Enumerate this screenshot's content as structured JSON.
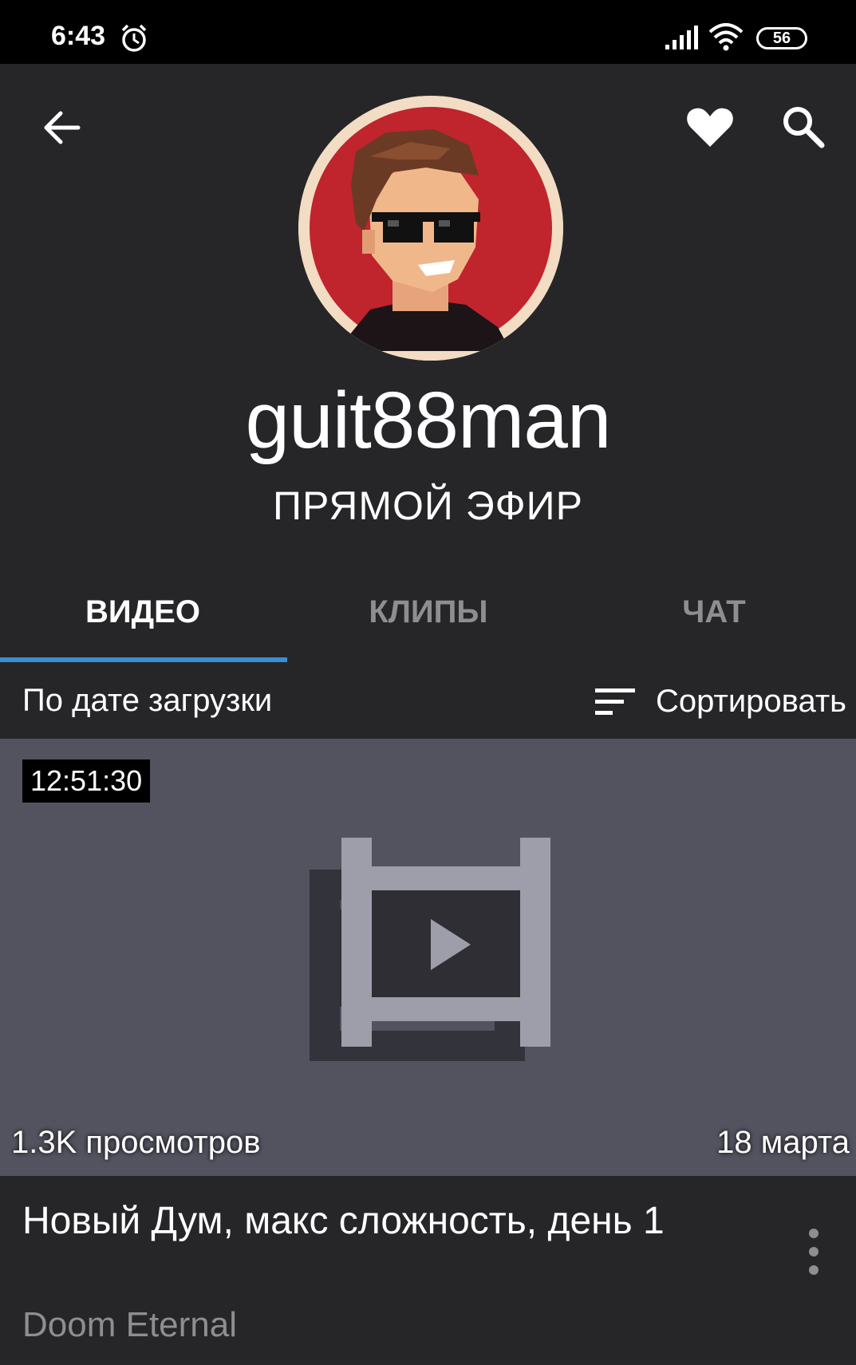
{
  "status_bar": {
    "time": "6:43",
    "battery": "56"
  },
  "header": {
    "channel_name": "guit88man",
    "live_label": "ПРЯМОЙ ЭФИР"
  },
  "tabs": [
    {
      "label": "ВИДЕО",
      "active": true
    },
    {
      "label": "КЛИПЫ",
      "active": false
    },
    {
      "label": "ЧАТ",
      "active": false
    }
  ],
  "sort_bar": {
    "current_sort": "По дате загрузки",
    "sort_button_label": "Сортировать"
  },
  "video": {
    "duration": "12:51:30",
    "views": "1.3K просмотров",
    "date": "18 марта",
    "title": "Новый Дум, макс сложность, день 1",
    "game": "Doom Eternal"
  },
  "colors": {
    "accent_tab_indicator": "#3a8fd4",
    "background": "#262628",
    "thumbnail_bg": "#535360",
    "avatar_red": "#c0242d"
  }
}
